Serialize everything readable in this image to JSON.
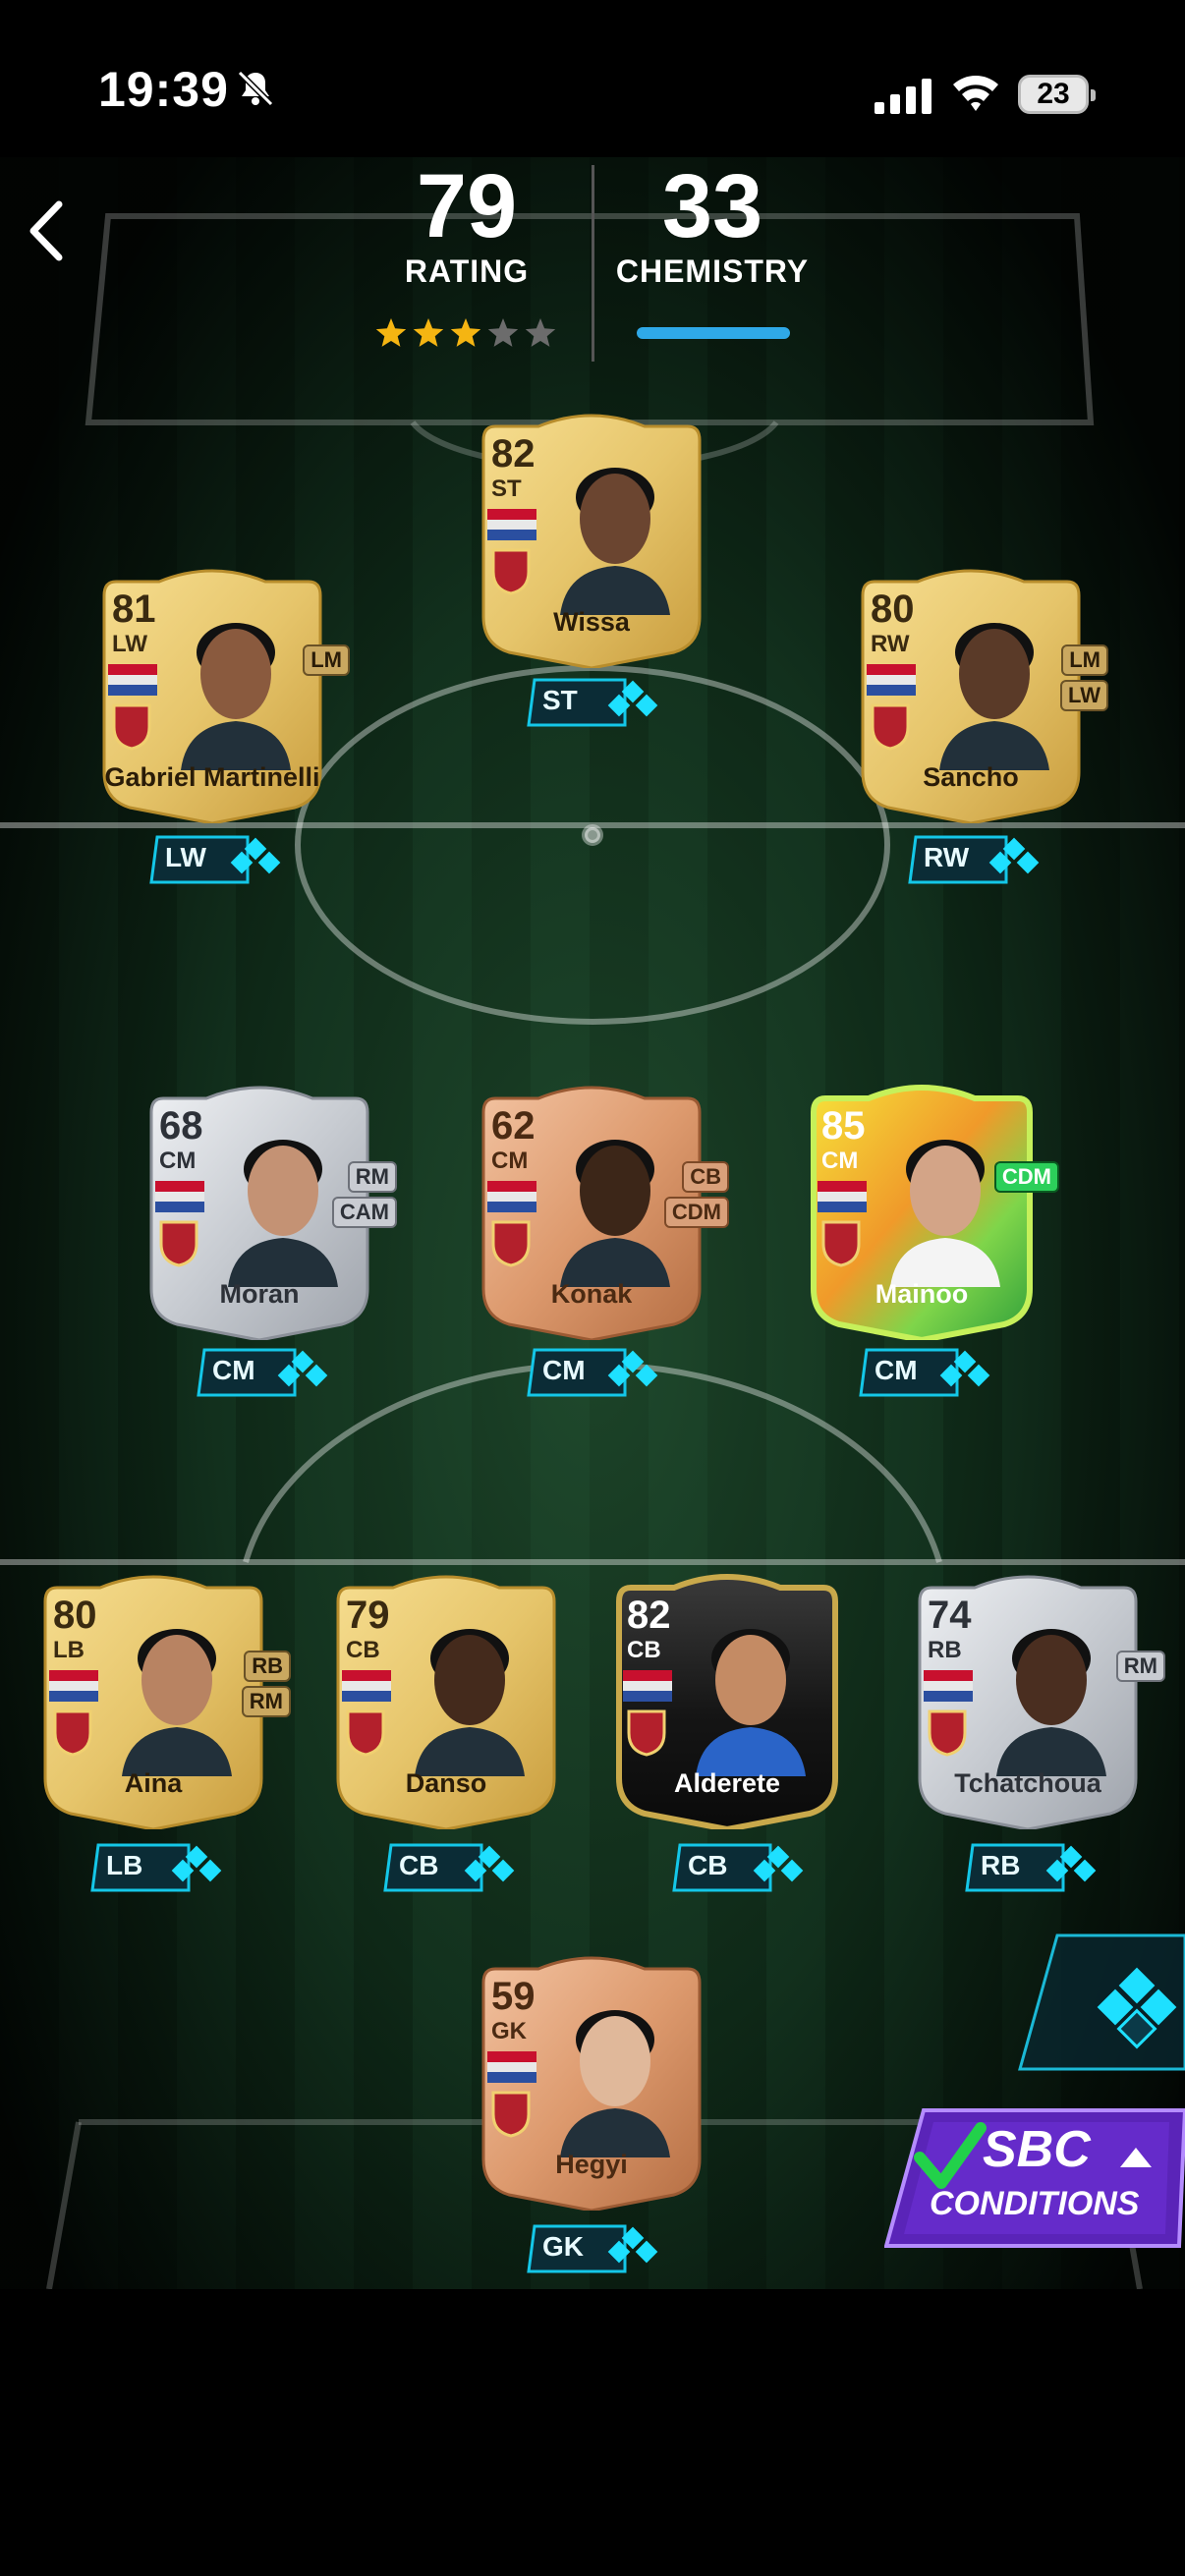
{
  "status_bar": {
    "time": "19:39",
    "battery": "23"
  },
  "header": {
    "rating_value": "79",
    "rating_label": "RATING",
    "rating_stars": 3,
    "rating_stars_max": 5,
    "chemistry_value": "33",
    "chemistry_label": "CHEMISTRY"
  },
  "players": [
    {
      "id": "wissa",
      "rating": "82",
      "pos": "ST",
      "name": "Wissa",
      "alt": [],
      "chip": "ST",
      "tier": "gold"
    },
    {
      "id": "martinelli",
      "rating": "81",
      "pos": "LW",
      "name": "Gabriel Martinelli",
      "alt": [
        "LM"
      ],
      "chip": "LW",
      "tier": "gold"
    },
    {
      "id": "sancho",
      "rating": "80",
      "pos": "RW",
      "name": "Sancho",
      "alt": [
        "LM",
        "LW"
      ],
      "chip": "RW",
      "tier": "gold"
    },
    {
      "id": "moran",
      "rating": "68",
      "pos": "CM",
      "name": "Moran",
      "alt": [
        "RM",
        "CAM"
      ],
      "chip": "CM",
      "tier": "silver"
    },
    {
      "id": "konak",
      "rating": "62",
      "pos": "CM",
      "name": "Konak",
      "alt": [
        "CB",
        "CDM"
      ],
      "chip": "CM",
      "tier": "bronze"
    },
    {
      "id": "mainoo",
      "rating": "85",
      "pos": "CM",
      "name": "Mainoo",
      "alt": [
        "CDM"
      ],
      "chip": "CM",
      "tier": "hero"
    },
    {
      "id": "aina",
      "rating": "80",
      "pos": "LB",
      "name": "Aina",
      "alt": [
        "RB",
        "RM"
      ],
      "chip": "LB",
      "tier": "gold"
    },
    {
      "id": "danso",
      "rating": "79",
      "pos": "CB",
      "name": "Danso",
      "alt": [],
      "chip": "CB",
      "tier": "gold"
    },
    {
      "id": "alderete",
      "rating": "82",
      "pos": "CB",
      "name": "Alderete",
      "alt": [],
      "chip": "CB",
      "tier": "special"
    },
    {
      "id": "tchatchoua",
      "rating": "74",
      "pos": "RB",
      "name": "Tchatchoua",
      "alt": [
        "RM"
      ],
      "chip": "RB",
      "tier": "silver"
    },
    {
      "id": "hegyi",
      "rating": "59",
      "pos": "GK",
      "name": "Hegyi",
      "alt": [],
      "chip": "GK",
      "tier": "bronze"
    }
  ],
  "sbc_button": {
    "line1": "SBC",
    "line2": "CONDITIONS"
  },
  "icons": {
    "back": "chevron-left-icon",
    "bell": "bell-slash-icon",
    "signal": "cellular-signal-icon",
    "wifi": "wifi-icon",
    "chemistry": "chemistry-diamonds-icon",
    "builder": "squad-builder-icon"
  },
  "colors": {
    "accent": "#2fa9e8",
    "chip": "#14c7e8",
    "star_on": "#f5b512",
    "star_off": "#6c6c6c",
    "sbc": "#6a2fd0"
  }
}
